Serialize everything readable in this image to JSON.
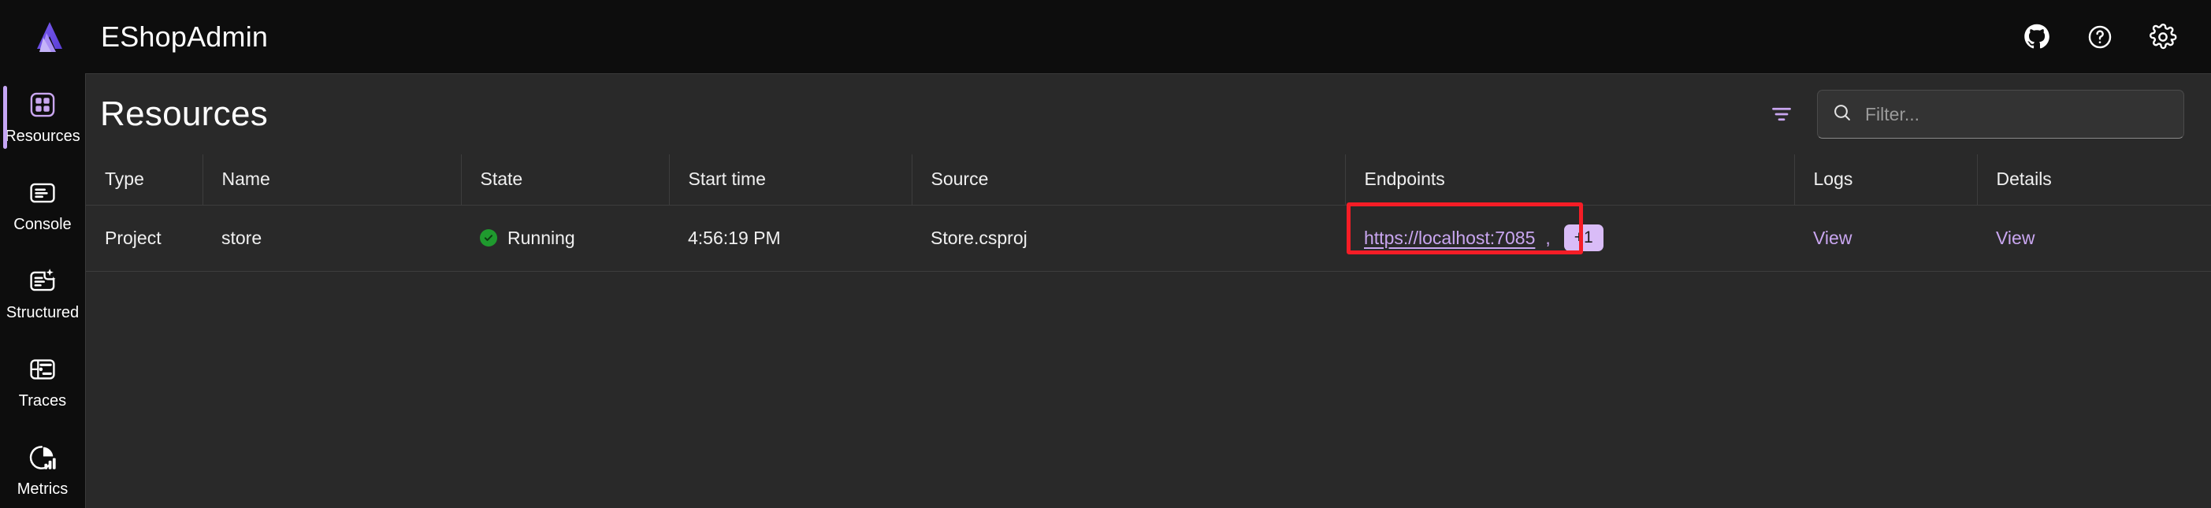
{
  "app": {
    "title": "EShopAdmin",
    "logo_icon": "aspire-logo-icon"
  },
  "topbar": {
    "actions": [
      {
        "name": "github-icon",
        "label": "GitHub"
      },
      {
        "name": "help-icon",
        "label": "Help"
      },
      {
        "name": "gear-icon",
        "label": "Settings"
      }
    ]
  },
  "sidebar": {
    "items": [
      {
        "label": "Resources",
        "icon": "resources-icon",
        "active": true
      },
      {
        "label": "Console",
        "icon": "console-icon",
        "active": false
      },
      {
        "label": "Structured",
        "icon": "structured-icon",
        "active": false
      },
      {
        "label": "Traces",
        "icon": "traces-icon",
        "active": false
      },
      {
        "label": "Metrics",
        "icon": "metrics-icon",
        "active": false
      }
    ]
  },
  "page": {
    "title": "Resources",
    "filter_toggle_icon": "filter-icon",
    "search": {
      "icon": "search-icon",
      "placeholder": "Filter...",
      "value": ""
    }
  },
  "table": {
    "columns": [
      "Type",
      "Name",
      "State",
      "Start time",
      "Source",
      "Endpoints",
      "Logs",
      "Details"
    ],
    "rows": [
      {
        "type": "Project",
        "name": "store",
        "state": "Running",
        "state_icon": "checkmark-circle-icon",
        "start_time": "4:56:19 PM",
        "source": "Store.csproj",
        "endpoint_url": "https://localhost:7085",
        "endpoint_separator": ",",
        "endpoint_more_badge": "+1",
        "logs_link": "View",
        "details_link": "View"
      }
    ]
  },
  "annotation": {
    "type": "highlight-rectangle",
    "color": "#f51d26",
    "target": "endpoint-link"
  },
  "colors": {
    "background": "#0d0d0d",
    "panel": "#292929",
    "accent": "#c9a6f0",
    "status_running": "#1f9a2e",
    "annotation": "#f51d26",
    "text": "#f0f0f0"
  }
}
